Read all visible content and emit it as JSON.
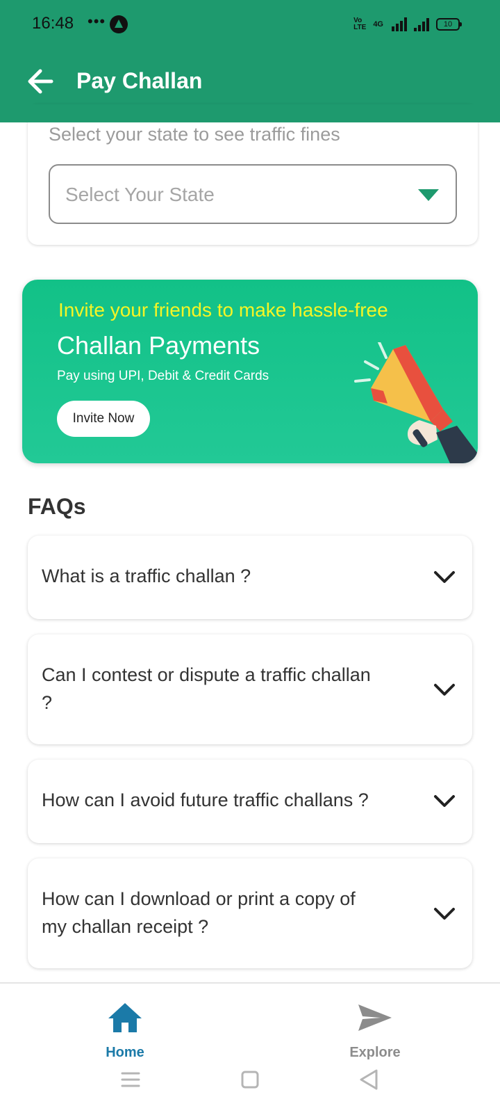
{
  "status_bar": {
    "time": "16:48",
    "dots": "•••",
    "volte_line1": "Vo",
    "volte_line2": "LTE",
    "network": "4G",
    "battery": "10"
  },
  "header": {
    "title": "Pay Challan",
    "back_icon": "arrow-left-icon"
  },
  "state_section": {
    "hint": "Select your state to see traffic fines",
    "select_placeholder": "Select Your State"
  },
  "promo": {
    "line1": "Invite your friends to make hassle-free",
    "line2": "Challan Payments",
    "line3": "Pay using UPI, Debit & Credit Cards",
    "button_label": "Invite Now",
    "image_icon": "megaphone-icon"
  },
  "faqs": {
    "title": "FAQs",
    "items": [
      {
        "question": "What is a traffic challan ?"
      },
      {
        "question": "Can I contest or dispute a traffic challan ?"
      },
      {
        "question": "How can I avoid future traffic challans ?"
      },
      {
        "question": "How can I download or print a copy of my challan receipt ?"
      }
    ]
  },
  "bottom_nav": {
    "items": [
      {
        "label": "Home",
        "icon": "home-icon",
        "active": true
      },
      {
        "label": "Explore",
        "icon": "send-icon",
        "active": false
      }
    ]
  },
  "colors": {
    "primary": "#1e9a6e",
    "promo_gradient_top": "#12c187",
    "promo_headline": "#f5f525",
    "nav_active": "#1b7aa8",
    "nav_inactive": "#8c8c8c"
  }
}
